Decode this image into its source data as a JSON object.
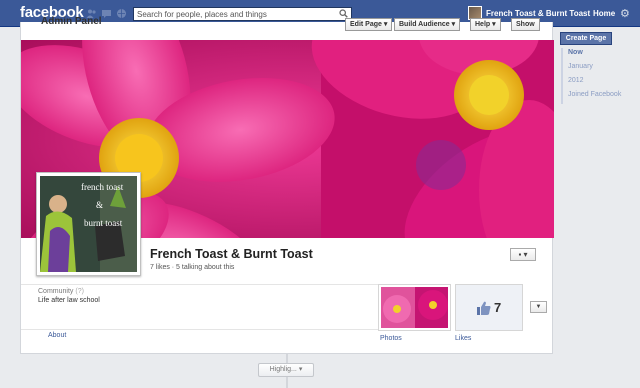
{
  "topbar": {
    "logo": "facebook",
    "search_placeholder": "Search for people, places and things",
    "user_name": "French Toast & Burnt Toast",
    "home_label": "Home",
    "icons": [
      "friend-requests-icon",
      "messages-icon",
      "notifications-icon",
      "search-icon",
      "gear-icon"
    ]
  },
  "admin": {
    "title": "Admin Panel",
    "edit_page": "Edit Page",
    "build_audience": "Build Audience",
    "help": "Help",
    "show": "Show"
  },
  "page": {
    "name": "French Toast & Burnt Toast",
    "stats": "7 likes · 5 talking about this",
    "profile_text_1": "french toast",
    "profile_text_2": "&",
    "profile_text_3": "burnt toast",
    "category": "Community",
    "category_tag": "(?)",
    "about": "Life after law school",
    "about_link": "About",
    "photos_label": "Photos",
    "likes_label": "Likes",
    "likes_count": "7"
  },
  "sidebar": {
    "create_page": "Create Page",
    "timeline": [
      "Now",
      "January",
      "2012",
      "Joined Facebook"
    ]
  },
  "footer": {
    "highlights": "Highlig... ▾"
  },
  "colors": {
    "brand_blue": "#3b5998",
    "flower_pink": "#d9157b",
    "flower_center": "#f2d22a"
  }
}
